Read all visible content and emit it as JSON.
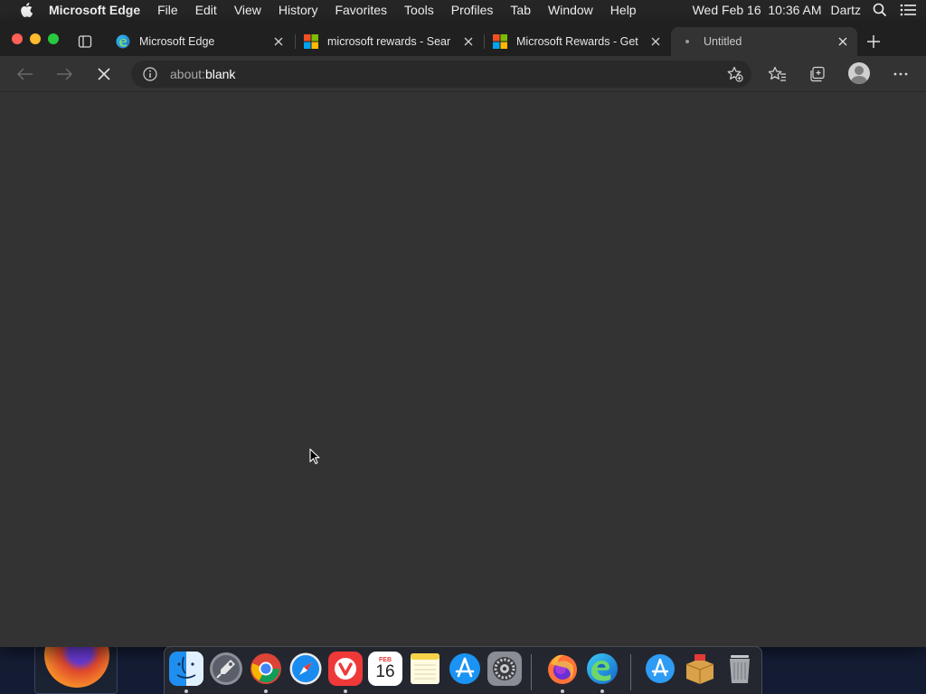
{
  "menubar": {
    "app_name": "Microsoft Edge",
    "menus": [
      "File",
      "Edit",
      "View",
      "History",
      "Favorites",
      "Tools",
      "Profiles",
      "Tab",
      "Window",
      "Help"
    ],
    "clock": "Wed Feb 16  10:36 AM",
    "user": "Dartz"
  },
  "tabs": [
    {
      "title": "Microsoft Edge",
      "favicon": "edge-icon",
      "active": false
    },
    {
      "title": "microsoft rewards - Sear",
      "favicon": "microsoft-logo-icon",
      "active": false
    },
    {
      "title": "Microsoft Rewards - Get",
      "favicon": "microsoft-logo-icon",
      "active": false
    },
    {
      "title": "Untitled",
      "favicon": "loading-dot-icon",
      "active": true
    }
  ],
  "toolbar": {
    "url_scheme": "about:",
    "url_path": "blank"
  },
  "dock": {
    "apps": [
      "Finder",
      "Launchpad",
      "Google Chrome",
      "Safari",
      "Vivaldi",
      "Calendar",
      "Notes",
      "App Store",
      "System Preferences",
      "Firefox",
      "Microsoft Edge",
      "App Store Downloads",
      "Archive Utility",
      "Trash"
    ],
    "calendar_month": "FEB",
    "calendar_day": "16"
  },
  "colors": {
    "window_bg": "#333333",
    "tabstrip_bg": "#202020",
    "menubar_bg": "#262626",
    "accent_close": "#ff5f57",
    "accent_min": "#febc2e",
    "accent_max": "#28c840"
  }
}
